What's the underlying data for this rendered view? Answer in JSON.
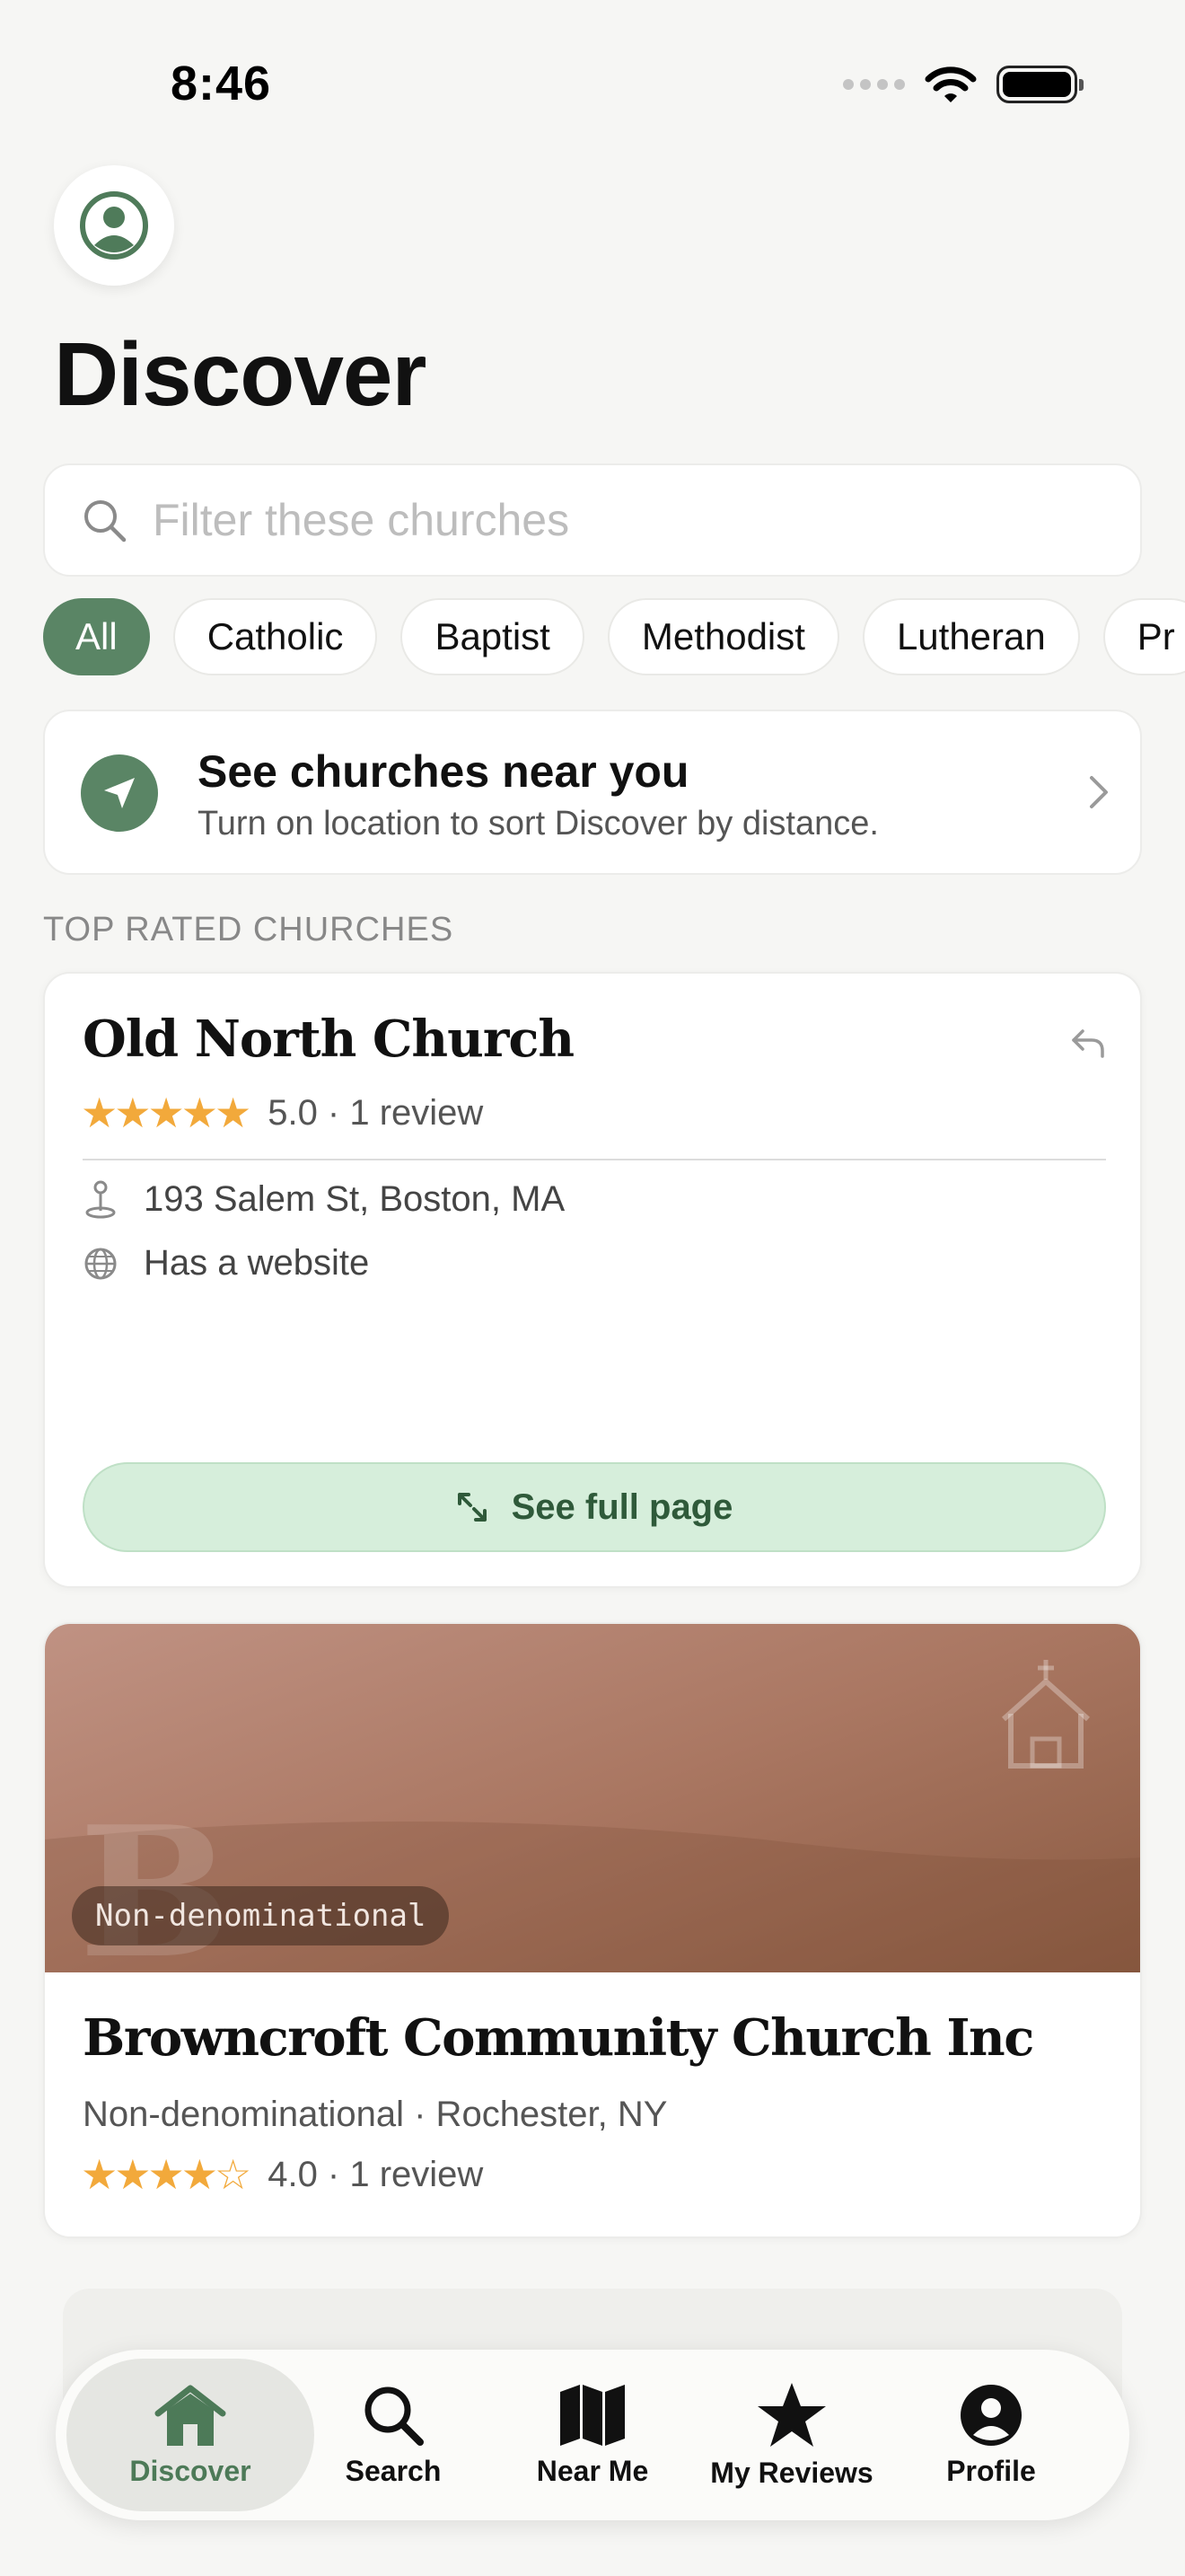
{
  "status": {
    "time": "8:46"
  },
  "header": {
    "title": "Discover"
  },
  "search": {
    "placeholder": "Filter these churches"
  },
  "filters": [
    "All",
    "Catholic",
    "Baptist",
    "Methodist",
    "Lutheran",
    "Pr"
  ],
  "location_prompt": {
    "title": "See churches near you",
    "subtitle": "Turn on location to sort Discover by distance."
  },
  "section": {
    "label": "TOP RATED CHURCHES"
  },
  "cards": [
    {
      "name": "Old North Church",
      "stars": "★★★★★",
      "rating_text": "5.0 · 1 review",
      "address": "193 Salem St, Boston, MA",
      "website": "Has a website",
      "cta": "See full page"
    },
    {
      "name": "Browncroft Community Church Inc",
      "badge": "Non-denominational",
      "letter": "B",
      "subtitle": "Non-denominational · Rochester, NY",
      "stars": "★★★★☆",
      "rating_text": "4.0 · 1 review"
    }
  ],
  "tabs": [
    "Discover",
    "Search",
    "Near Me",
    "My Reviews",
    "Profile"
  ],
  "colors": {
    "accent": "#5a8565",
    "star": "#f2a93b",
    "cta_bg": "#d6eedb"
  }
}
